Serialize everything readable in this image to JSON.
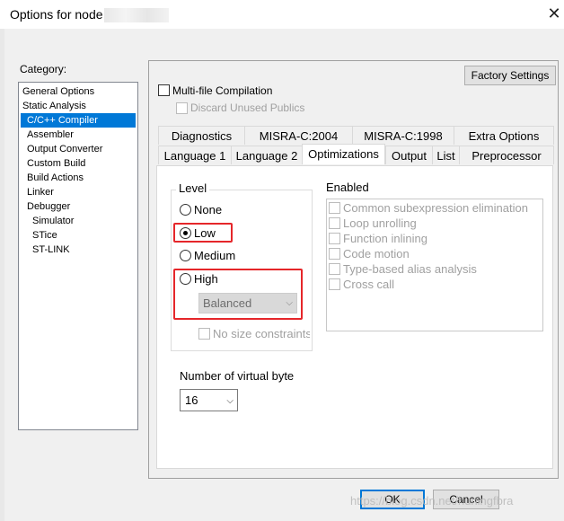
{
  "window": {
    "title": "Options for node",
    "close_glyph": "✕"
  },
  "category": {
    "label": "Category:",
    "items": [
      {
        "label": "General Options"
      },
      {
        "label": "Static Analysis"
      },
      {
        "label": "C/C++ Compiler"
      },
      {
        "label": "Assembler"
      },
      {
        "label": "Output Converter"
      },
      {
        "label": "Custom Build"
      },
      {
        "label": "Build Actions"
      },
      {
        "label": "Linker"
      },
      {
        "label": "Debugger"
      },
      {
        "label": "Simulator"
      },
      {
        "label": "STice"
      },
      {
        "label": "ST-LINK"
      }
    ],
    "selected": "C/C++ Compiler"
  },
  "top": {
    "factory_settings": "Factory Settings",
    "multifile": "Multi-file Compilation",
    "discard": "Discard Unused Publics"
  },
  "tabs": {
    "row1": [
      "Diagnostics",
      "MISRA-C:2004",
      "MISRA-C:1998",
      "Extra Options"
    ],
    "row2": [
      "Language 1",
      "Language 2",
      "Optimizations",
      "Output",
      "List",
      "Preprocessor"
    ],
    "active": "Optimizations"
  },
  "optimizations": {
    "level_title": "Level",
    "levels": [
      "None",
      "Low",
      "Medium",
      "High"
    ],
    "selected_level": "Low",
    "high_mode": "Balanced",
    "no_size_constraints": "No size constraints",
    "enabled_title": "Enabled",
    "enabled_items": [
      "Common subexpression elimination",
      "Loop unrolling",
      "Function inlining",
      "Code motion",
      "Type-based alias analysis",
      "Cross call"
    ],
    "virtual_bytes_label": "Number of virtual byte",
    "virtual_bytes_value": "16"
  },
  "buttons": {
    "ok": "OK",
    "cancel": "Cancel"
  },
  "watermark": "https://blog.csdn.net/huningfbra",
  "colors": {
    "selection": "#0078d7",
    "highlight_box": "#e5262a"
  }
}
